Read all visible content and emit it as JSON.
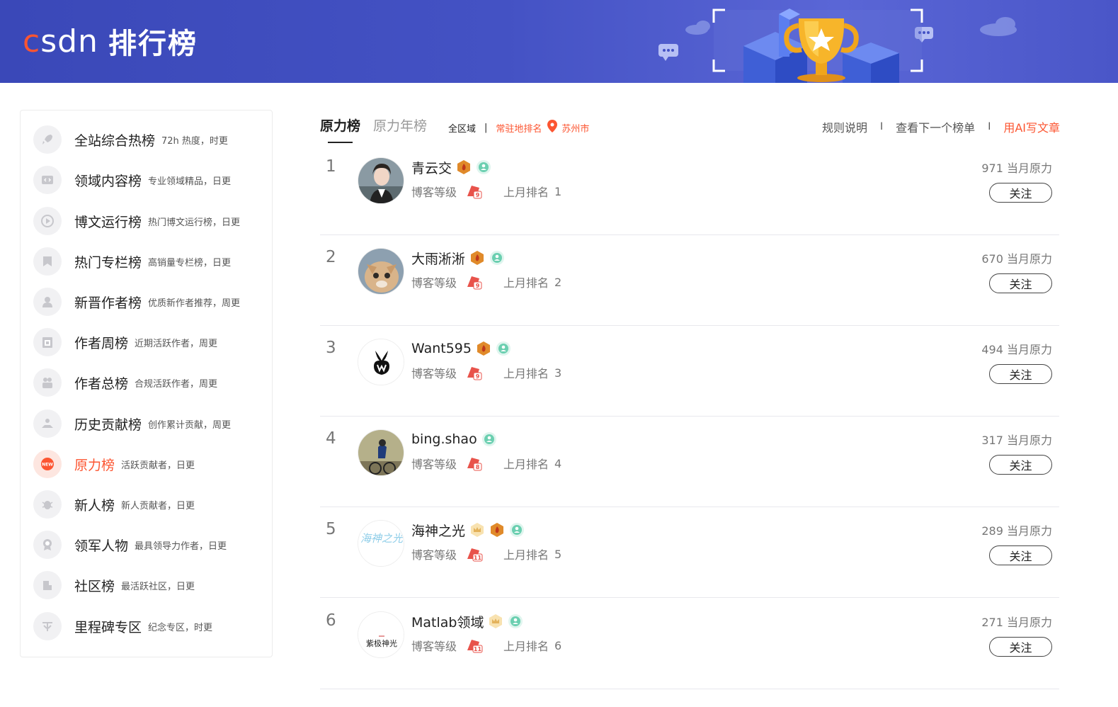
{
  "header": {
    "logo_text": "csdn",
    "title": "排行榜"
  },
  "sidebar": {
    "items": [
      {
        "label": "全站综合热榜",
        "desc": "72h 热度，时更",
        "icon": "rocket-icon"
      },
      {
        "label": "领域内容榜",
        "desc": "专业领域精品，日更",
        "icon": "code-icon"
      },
      {
        "label": "博文运行榜",
        "desc": "热门博文运行榜，日更",
        "icon": "play-icon"
      },
      {
        "label": "热门专栏榜",
        "desc": "高销量专栏榜，日更",
        "icon": "bookmark-icon"
      },
      {
        "label": "新晋作者榜",
        "desc": "优质新作者推荐，周更",
        "icon": "user-icon"
      },
      {
        "label": "作者周榜",
        "desc": "近期活跃作者，周更",
        "icon": "calendar-icon"
      },
      {
        "label": "作者总榜",
        "desc": "合规活跃作者，周更",
        "icon": "group-icon"
      },
      {
        "label": "历史贡献榜",
        "desc": "创作累计贡献，周更",
        "icon": "hand-icon"
      },
      {
        "label": "原力榜",
        "desc": "活跃贡献者，日更",
        "icon": "new-badge-icon",
        "active": true
      },
      {
        "label": "新人榜",
        "desc": "新人贡献者，日更",
        "icon": "bug-icon"
      },
      {
        "label": "领军人物",
        "desc": "最具领导力作者，日更",
        "icon": "medal-icon"
      },
      {
        "label": "社区榜",
        "desc": "最活跃社区，日更",
        "icon": "community-icon"
      },
      {
        "label": "里程碑专区",
        "desc": "纪念专区，时更",
        "icon": "milestone-icon"
      }
    ]
  },
  "tabs": [
    {
      "label": "原力榜",
      "active": true
    },
    {
      "label": "原力年榜",
      "active": false
    }
  ],
  "region": {
    "all": "全区域",
    "separator": "|",
    "local": "常驻地排名",
    "city": "苏州市"
  },
  "links": {
    "rules": "规则说明",
    "sep": "I",
    "next": "查看下一个榜单",
    "ai": "用AI写文章"
  },
  "labels": {
    "level": "博客等级",
    "last_rank": "上月排名",
    "follow": "关注"
  },
  "rows": [
    {
      "rank": "1",
      "name": "青云交",
      "level": "9",
      "last_rank": "1",
      "score": "971 当月原力",
      "badges": [
        "flame-badge-icon",
        "friend-badge-icon"
      ],
      "avatar_text": ""
    },
    {
      "rank": "2",
      "name": "大雨淅淅",
      "level": "9",
      "last_rank": "2",
      "score": "670 当月原力",
      "badges": [
        "flame-badge-icon",
        "friend-badge-icon"
      ],
      "avatar_text": ""
    },
    {
      "rank": "3",
      "name": "Want595",
      "level": "9",
      "last_rank": "3",
      "score": "494 当月原力",
      "badges": [
        "flame-badge-icon",
        "friend-badge-icon"
      ],
      "avatar_text": ""
    },
    {
      "rank": "4",
      "name": "bing.shao",
      "level": "8",
      "last_rank": "4",
      "score": "317 当月原力",
      "badges": [
        "friend-badge-icon"
      ],
      "avatar_text": ""
    },
    {
      "rank": "5",
      "name": "海神之光",
      "level": "11",
      "last_rank": "5",
      "score": "289 当月原力",
      "badges": [
        "crown-badge-icon",
        "flame-badge-icon",
        "friend-badge-icon"
      ],
      "avatar_text": "海神之光"
    },
    {
      "rank": "6",
      "name": "Matlab领域",
      "level": "11",
      "last_rank": "6",
      "score": "271 当月原力",
      "badges": [
        "crown-badge-icon",
        "friend-badge-icon"
      ],
      "avatar_text": "紫极神光"
    }
  ],
  "colors": {
    "accent": "#fc5531",
    "banner": "#4452c4"
  }
}
